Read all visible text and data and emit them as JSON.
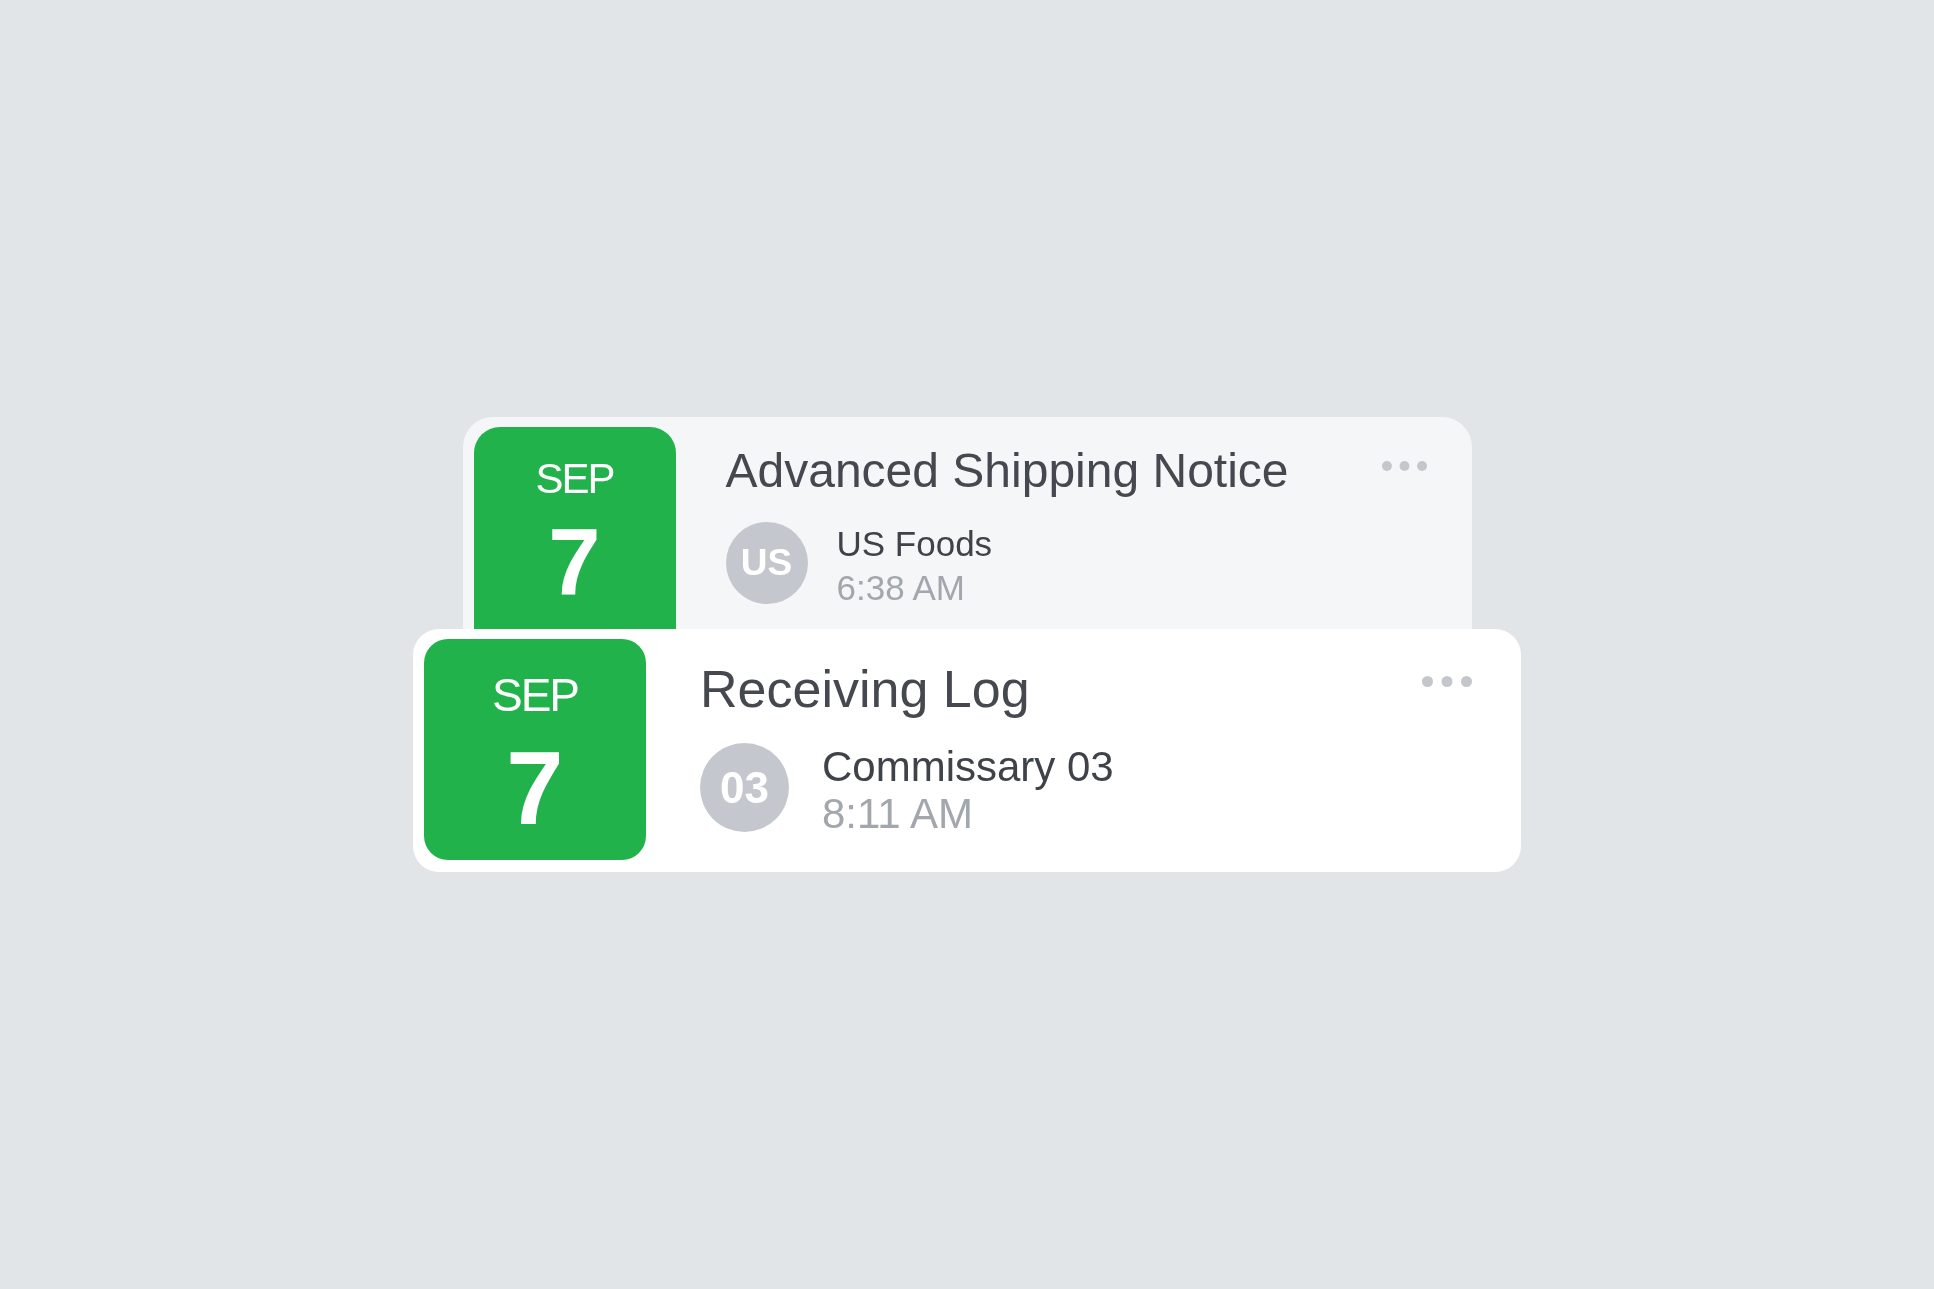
{
  "cards": [
    {
      "kind": "back",
      "date": {
        "month": "SEP",
        "day": "7"
      },
      "title": "Advanced Shipping Notice",
      "sender": {
        "initials": "US",
        "name": "US Foods",
        "time": "6:38 AM"
      }
    },
    {
      "kind": "front",
      "date": {
        "month": "SEP",
        "day": "7"
      },
      "title": "Receiving Log",
      "sender": {
        "initials": "03",
        "name": "Commissary 03",
        "time": "8:11 AM"
      }
    }
  ]
}
